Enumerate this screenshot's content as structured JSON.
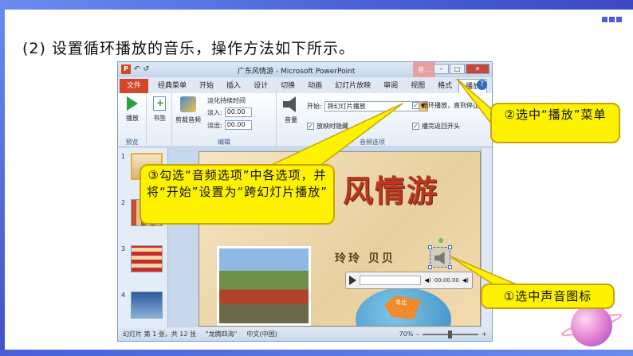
{
  "heading": "(2) 设置循环播放的音乐，操作方法如下所示。",
  "window": {
    "title": "广东风情游 - Microsoft PowerPoint",
    "context_tab": "音...",
    "qat_undo": "↶",
    "qat_redo": "↺",
    "min": "–",
    "max": "□",
    "close": "✕"
  },
  "tabs": [
    {
      "label": "文件"
    },
    {
      "label": "经典菜单"
    },
    {
      "label": "开始"
    },
    {
      "label": "插入"
    },
    {
      "label": "设计"
    },
    {
      "label": "切换"
    },
    {
      "label": "动画"
    },
    {
      "label": "幻灯片放映"
    },
    {
      "label": "审阅"
    },
    {
      "label": "视图"
    },
    {
      "label": "格式"
    },
    {
      "label": "播放"
    }
  ],
  "ribbon": {
    "play_label": "播放",
    "preview_group": "预览",
    "bookmark_label": "书签",
    "trim_label": "剪裁音频",
    "edit_group": "编辑",
    "fade_title": "淡化持续时间",
    "fade_in_label": "淡入:",
    "fade_in_value": "00.00",
    "fade_out_label": "淡出:",
    "fade_out_value": "00.00",
    "volume_label": "音量",
    "start_label": "开始:",
    "start_value": "跨幻灯片播放",
    "hide_label": "放映时隐藏",
    "loop_label": "循环播放，直到停止",
    "rewind_label": "播完返回开头",
    "options_group": "音频选项"
  },
  "slide": {
    "title": "风情游",
    "authors": "玲玲  贝贝",
    "map_label": "粤北",
    "time": "00:00.00"
  },
  "thumbnails": [
    {
      "num": "1"
    },
    {
      "num": "2"
    },
    {
      "num": "3"
    },
    {
      "num": "4"
    }
  ],
  "status": {
    "slide_info": "幻灯片 第 1 张，共 12 张",
    "theme": "\"龙腾四海\"",
    "language": "中文(中国)",
    "zoom": "70%"
  },
  "callouts": {
    "c3": "③勾选“音频选项”中各选项，并将“开始”设置为“跨幻灯片播放”",
    "c2": "②选中“播放”菜单",
    "c1": "①选中声音图标"
  },
  "colors": {
    "callout_fill": "#fff200",
    "accent_blue": "#4a5fd6",
    "file_tab": "#d24726"
  }
}
